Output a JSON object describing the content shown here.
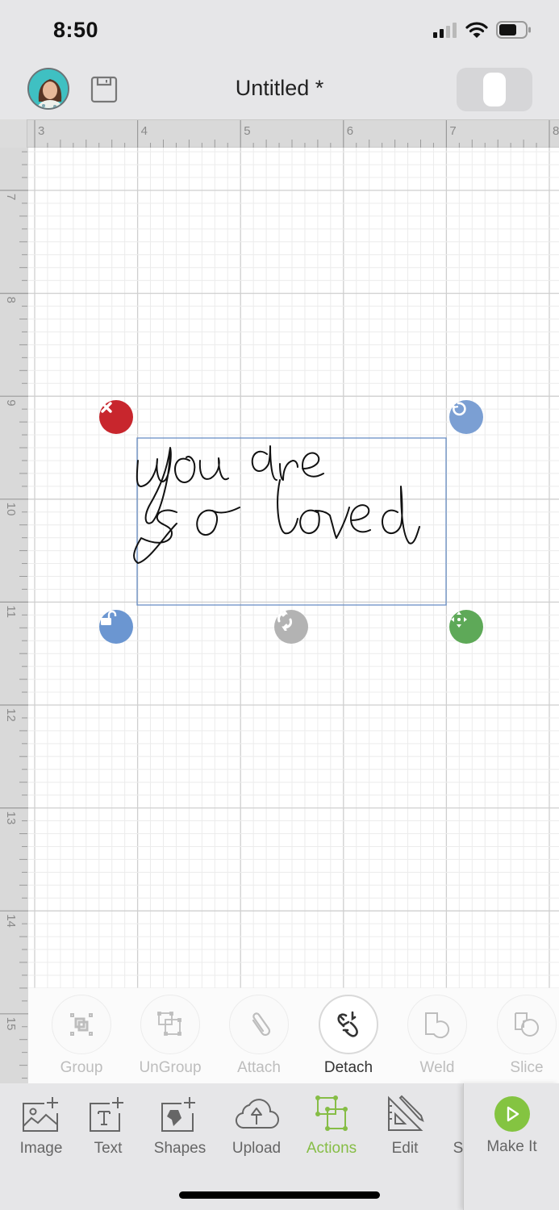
{
  "status_bar": {
    "time": "8:50",
    "signal_icon": "cellular-signal-icon",
    "wifi_icon": "wifi-icon",
    "battery_icon": "battery-icon"
  },
  "header": {
    "avatar_icon": "profile-avatar",
    "save_icon": "save-icon",
    "title": "Untitled *",
    "toggle_icon": "view-toggle"
  },
  "rulers": {
    "horizontal_labels": [
      "3",
      "4",
      "5",
      "6",
      "7",
      "8"
    ],
    "vertical_labels": [
      "7",
      "8",
      "9",
      "10",
      "11",
      "12",
      "13",
      "14",
      "15"
    ]
  },
  "canvas": {
    "design_text_line1": "you are",
    "design_text_line2": "so loved",
    "selection_color": "#6a8fc6",
    "handles": {
      "delete": {
        "icon": "close-icon",
        "color": "#c8262d"
      },
      "rotate": {
        "icon": "rotate-icon",
        "color": "#7b9fd3"
      },
      "lock": {
        "icon": "unlock-icon",
        "color": "#6b96d1"
      },
      "flip": {
        "icon": "flip-icon",
        "color": "#b3b3b3"
      },
      "move": {
        "icon": "move-icon",
        "color": "#5ea958"
      }
    }
  },
  "action_bar": {
    "items": [
      {
        "label": "Group",
        "icon": "group-icon",
        "enabled": false
      },
      {
        "label": "UnGroup",
        "icon": "ungroup-icon",
        "enabled": false
      },
      {
        "label": "Attach",
        "icon": "paperclip-icon",
        "enabled": false
      },
      {
        "label": "Detach",
        "icon": "detach-icon",
        "enabled": true
      },
      {
        "label": "Weld",
        "icon": "weld-icon",
        "enabled": false
      },
      {
        "label": "Slice",
        "icon": "slice-icon",
        "enabled": false
      }
    ]
  },
  "bottom_toolbar": {
    "items": [
      {
        "label": "Image",
        "icon": "image-add-icon"
      },
      {
        "label": "Text",
        "icon": "text-add-icon"
      },
      {
        "label": "Shapes",
        "icon": "shapes-add-icon"
      },
      {
        "label": "Upload",
        "icon": "cloud-upload-icon"
      },
      {
        "label": "Actions",
        "icon": "actions-icon",
        "active": true
      },
      {
        "label": "Edit",
        "icon": "edit-ruler-icon"
      },
      {
        "label": "S",
        "icon": "sync-icon"
      }
    ],
    "make_it_label": "Make It",
    "active_color": "#86bd46"
  }
}
